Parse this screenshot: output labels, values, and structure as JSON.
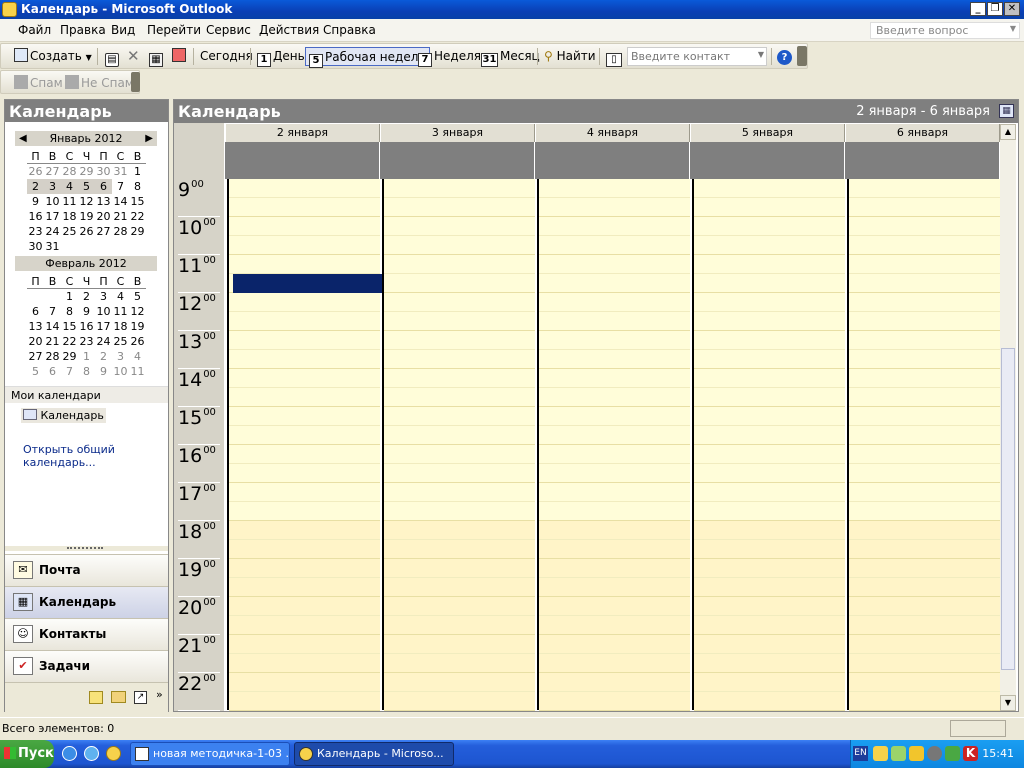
{
  "window": {
    "title": "Календарь - Microsoft Outlook"
  },
  "menu": {
    "items": [
      "Файл",
      "Правка",
      "Вид",
      "Перейти",
      "Сервис",
      "Действия",
      "Справка"
    ],
    "ask_placeholder": "Введите вопрос"
  },
  "toolbar": {
    "create": "Создать",
    "today": "Сегодня",
    "day": "День",
    "work_week": "Рабочая неделя",
    "week": "Неделя",
    "month": "Месяц",
    "find": "Найти",
    "contact_placeholder": "Введите контакт",
    "day_num": "1",
    "work_week_num": "5",
    "week_num": "7",
    "month_num": "31",
    "spam": "Спам",
    "not_spam": "Не Спам"
  },
  "left_pane": {
    "title": "Календарь",
    "jan": {
      "header": "Январь 2012",
      "dow": [
        "П",
        "В",
        "С",
        "Ч",
        "П",
        "С",
        "В"
      ],
      "rows": [
        [
          "26",
          "27",
          "28",
          "29",
          "30",
          "31",
          "1"
        ],
        [
          "2",
          "3",
          "4",
          "5",
          "6",
          "7",
          "8"
        ],
        [
          "9",
          "10",
          "11",
          "12",
          "13",
          "14",
          "15"
        ],
        [
          "16",
          "17",
          "18",
          "19",
          "20",
          "21",
          "22"
        ],
        [
          "23",
          "24",
          "25",
          "26",
          "27",
          "28",
          "29"
        ],
        [
          "30",
          "31",
          "",
          "",
          "",
          "",
          ""
        ]
      ]
    },
    "feb": {
      "header": "Февраль 2012",
      "dow": [
        "П",
        "В",
        "С",
        "Ч",
        "П",
        "С",
        "В"
      ],
      "rows": [
        [
          "",
          "",
          "1",
          "2",
          "3",
          "4",
          "5"
        ],
        [
          "6",
          "7",
          "8",
          "9",
          "10",
          "11",
          "12"
        ],
        [
          "13",
          "14",
          "15",
          "16",
          "17",
          "18",
          "19"
        ],
        [
          "20",
          "21",
          "22",
          "23",
          "24",
          "25",
          "26"
        ],
        [
          "27",
          "28",
          "29",
          "1",
          "2",
          "3",
          "4"
        ],
        [
          "5",
          "6",
          "7",
          "8",
          "9",
          "10",
          "11"
        ]
      ]
    },
    "my_calendars": "Мои календари",
    "calendar_item": "Календарь",
    "open_shared": "Открыть общий календарь...",
    "nav": {
      "mail": "Почта",
      "calendar": "Календарь",
      "contacts": "Контакты",
      "tasks": "Задачи"
    }
  },
  "right_pane": {
    "title": "Календарь",
    "range": "2 января - 6 января",
    "days": [
      "2 января",
      "3 января",
      "4 января",
      "5 января",
      "6 января"
    ],
    "hours": [
      "9",
      "10",
      "11",
      "12",
      "13",
      "14",
      "15",
      "16",
      "17",
      "18",
      "19",
      "20",
      "21",
      "22"
    ],
    "minutes": "00"
  },
  "status": {
    "text": "Всего элементов: 0"
  },
  "taskbar": {
    "start": "Пуск",
    "tasks": [
      "новая методичка-1-03 ...",
      "Календарь - Microso..."
    ],
    "lang": "EN",
    "clock": "15:41"
  },
  "colors": {
    "work_hours": "#fffdd9",
    "after_hours": "#fff4c8",
    "selection": "#0a246a",
    "header_gray": "#7f7f7f"
  }
}
